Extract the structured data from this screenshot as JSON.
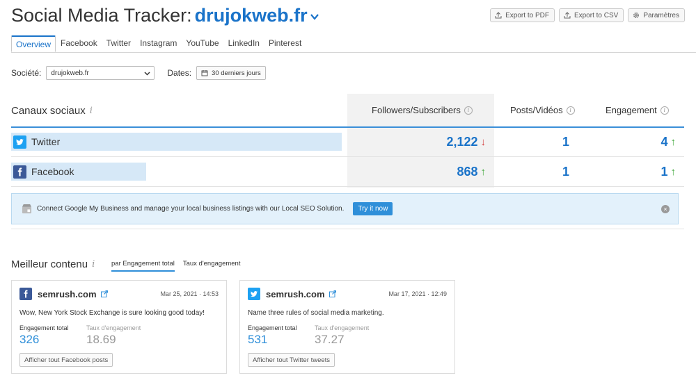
{
  "header": {
    "title_static": "Social Media Tracker:",
    "domain": "drujokweb.fr",
    "actions": [
      {
        "label": "Export to PDF",
        "icon": "export-icon"
      },
      {
        "label": "Export to CSV",
        "icon": "export-icon"
      },
      {
        "label": "Paramètres",
        "icon": "gear-icon"
      }
    ]
  },
  "tabs": [
    "Overview",
    "Facebook",
    "Twitter",
    "Instagram",
    "YouTube",
    "LinkedIn",
    "Pinterest"
  ],
  "active_tab": "Overview",
  "filters": {
    "company_label": "Société:",
    "company_value": "drujokweb.fr",
    "dates_label": "Dates:",
    "dates_value": "30 derniers jours"
  },
  "social_table": {
    "title": "Canaux sociaux",
    "columns": [
      "Followers/Subscribers",
      "Posts/Vidéos",
      "Engagement"
    ],
    "rows": [
      {
        "network": "Twitter",
        "icon": "twitter-icon",
        "followers": "2,122",
        "followers_trend": "down",
        "posts": "1",
        "engagement": "4",
        "engagement_trend": "up"
      },
      {
        "network": "Facebook",
        "icon": "facebook-icon",
        "followers": "868",
        "followers_trend": "up",
        "posts": "1",
        "engagement": "1",
        "engagement_trend": "up"
      }
    ]
  },
  "banner": {
    "text": "Connect Google My Business and manage your local business listings with our Local SEO Solution.",
    "button": "Try it now"
  },
  "best_content": {
    "title": "Meilleur contenu",
    "sort_tabs": [
      "par Engagement total",
      "Taux d'engagement"
    ],
    "cards": [
      {
        "network": "facebook",
        "icon": "facebook-icon",
        "name": "semrush.com",
        "date": "Mar 25, 2021 · 14:53",
        "text": "Wow, New York Stock Exchange is sure looking good today!",
        "engagement_label": "Engagement total",
        "engagement_value": "326",
        "rate_label": "Taux d'engagement",
        "rate_value": "18.69",
        "button": "Afficher tout Facebook posts"
      },
      {
        "network": "twitter",
        "icon": "twitter-icon",
        "name": "semrush.com",
        "date": "Mar 17, 2021 · 12:49",
        "text": "Name three rules of social media marketing.",
        "engagement_label": "Engagement total",
        "engagement_value": "531",
        "rate_label": "Taux d'engagement",
        "rate_value": "37.27",
        "button": "Afficher tout Twitter tweets"
      }
    ]
  },
  "colors": {
    "accent": "#1a73c9",
    "twitter": "#1da1f2",
    "facebook": "#3b5998",
    "trend_up": "#3aa535",
    "trend_down": "#d33c3c",
    "banner_bg": "#e3f1fb"
  }
}
